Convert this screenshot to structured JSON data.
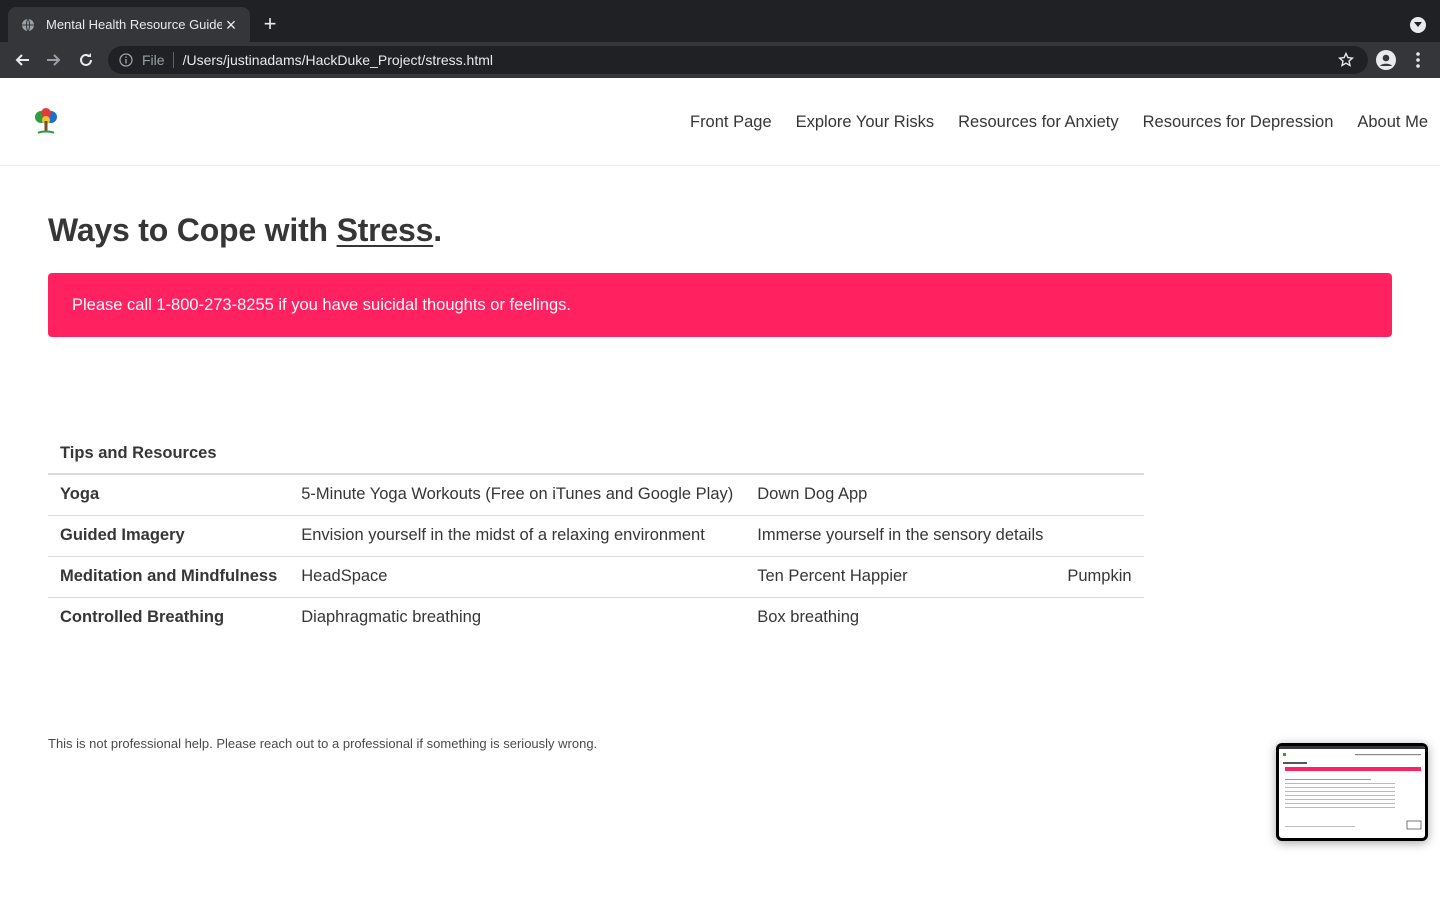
{
  "browser": {
    "tab_title": "Mental Health Resource Guide",
    "address_prefix": "File",
    "address_url": "/Users/justinadams/HackDuke_Project/stress.html",
    "icons": [
      "globe-icon",
      "close-icon",
      "plus-icon",
      "chevron-down-icon",
      "back-arrow-icon",
      "forward-arrow-icon",
      "reload-icon",
      "info-icon",
      "star-icon",
      "profile-icon",
      "more-vertical-icon"
    ]
  },
  "nav": {
    "links": [
      "Front Page",
      "Explore Your Risks",
      "Resources for Anxiety",
      "Resources for Depression",
      "About Me"
    ]
  },
  "heading": {
    "prefix": "Ways to Cope with ",
    "link": "Stress",
    "suffix": "."
  },
  "alert": {
    "text": "Please call 1-800-273-8255 if you have suicidal thoughts or feelings.",
    "color": "#ff2160"
  },
  "table": {
    "header": "Tips and Resources",
    "rows": [
      {
        "label": "Yoga",
        "cells": [
          "5-Minute Yoga Workouts (Free on iTunes and Google Play)",
          "Down Dog App",
          ""
        ]
      },
      {
        "label": "Guided Imagery",
        "cells": [
          "Envision yourself in the midst of a relaxing environment",
          "Immerse yourself in the sensory details",
          ""
        ]
      },
      {
        "label": "Meditation and Mindfulness",
        "cells": [
          "HeadSpace",
          "Ten Percent Happier",
          "Pumpkin"
        ]
      },
      {
        "label": "Controlled Breathing",
        "cells": [
          "Diaphragmatic breathing",
          "Box breathing",
          ""
        ]
      }
    ]
  },
  "footer": {
    "note": "This is not professional help. Please reach out to a professional if something is seriously wrong."
  }
}
